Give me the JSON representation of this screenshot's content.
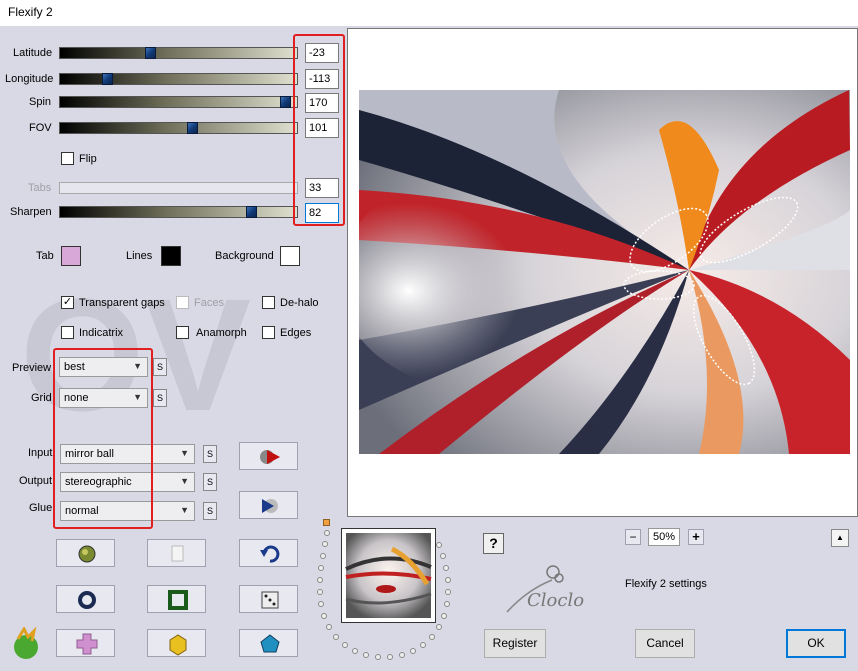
{
  "window": {
    "title": "Flexify 2"
  },
  "sliders": {
    "latitude": {
      "label": "Latitude",
      "value": "-23"
    },
    "longitude": {
      "label": "Longitude",
      "value": "-113"
    },
    "spin": {
      "label": "Spin",
      "value": "170"
    },
    "fov": {
      "label": "FOV",
      "value": "101"
    },
    "tabs": {
      "label": "Tabs",
      "value": "33"
    },
    "sharpen": {
      "label": "Sharpen",
      "value": "82"
    }
  },
  "flip": {
    "label": "Flip",
    "checked": false
  },
  "colors": {
    "tab": {
      "label": "Tab",
      "color": "#d8a8d8"
    },
    "lines": {
      "label": "Lines",
      "color": "#000000"
    },
    "background": {
      "label": "Background",
      "color": "#ffffff"
    }
  },
  "options": {
    "transparent_gaps": {
      "label": "Transparent gaps",
      "checked": true
    },
    "faces": {
      "label": "Faces",
      "checked": false
    },
    "de_halo": {
      "label": "De-halo",
      "checked": false
    },
    "indicatrix": {
      "label": "Indicatrix",
      "checked": false
    },
    "anamorph": {
      "label": "Anamorph",
      "checked": false
    },
    "edges": {
      "label": "Edges",
      "checked": false
    }
  },
  "dropdowns": {
    "preview": {
      "label": "Preview",
      "value": "best"
    },
    "grid": {
      "label": "Grid",
      "value": "none"
    },
    "input": {
      "label": "Input",
      "value": "mirror ball"
    },
    "output": {
      "label": "Output",
      "value": "stereographic"
    },
    "glue": {
      "label": "Glue",
      "value": "normal"
    }
  },
  "s_button": "S",
  "zoom": {
    "minus": "−",
    "value": "50%",
    "plus": "+",
    "up": "▲"
  },
  "settings_label": "Flexify 2 settings",
  "help": "?",
  "logo_text": "Cloclo",
  "buttons": {
    "register": "Register",
    "cancel": "Cancel",
    "ok": "OK"
  }
}
